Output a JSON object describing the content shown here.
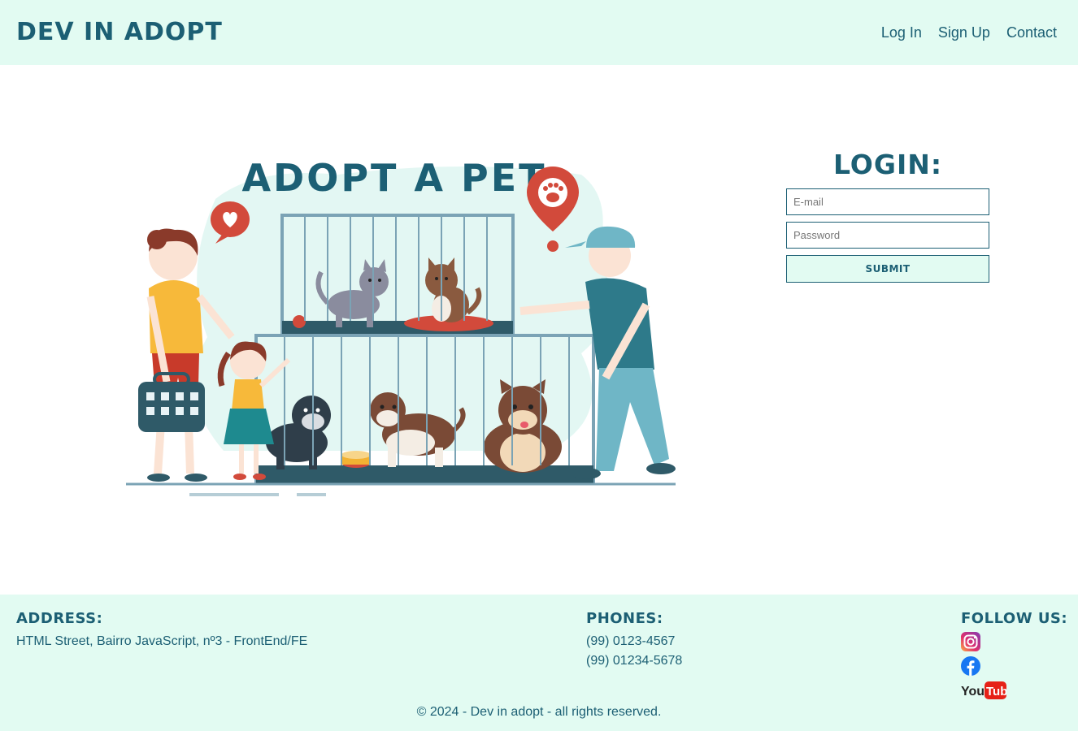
{
  "header": {
    "logo": "Dev in adopt",
    "nav": [
      "Log In",
      "Sign Up",
      "Contact"
    ]
  },
  "hero": {
    "title": "ADOPT A PET"
  },
  "login": {
    "title": "Login:",
    "email_placeholder": "E-mail",
    "password_placeholder": "Password",
    "submit_label": "Submit"
  },
  "footer": {
    "address_title": "Address:",
    "address": "HTML Street, Bairro JavaScript, nº3 - FrontEnd/FE",
    "phones_title": "Phones:",
    "phones": [
      "(99) 0123-4567",
      "(99) 01234-5678"
    ],
    "follow_title": "Follow us:",
    "social": [
      "instagram-icon",
      "facebook-icon",
      "youtube-icon"
    ],
    "youtube_text": "YouTube",
    "copyright": "© 2024 - Dev in adopt - all rights reserved."
  },
  "colors": {
    "brand": "#1c5f74",
    "header_bg": "#e2fbf2",
    "accent_red": "#d24a3b"
  }
}
